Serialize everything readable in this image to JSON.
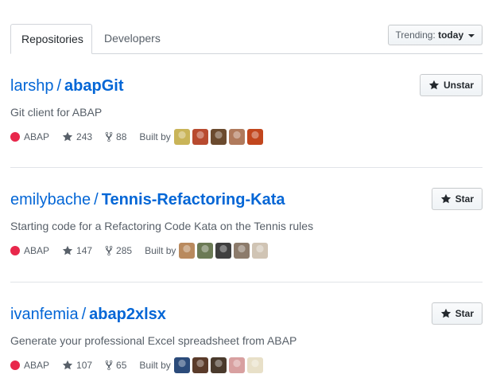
{
  "tabs": [
    {
      "label": "Repositories",
      "active": true
    },
    {
      "label": "Developers",
      "active": false
    }
  ],
  "trending": {
    "label": "Trending:",
    "value": "today"
  },
  "language_color": "#e8274b",
  "repos": [
    {
      "owner": "larshp",
      "separator": "/",
      "name": "abapGit",
      "description": "Git client for ABAP",
      "language": "ABAP",
      "stars": "243",
      "forks": "88",
      "built_by": "Built by",
      "star_button": "Unstar",
      "avatars": [
        "#c9b458",
        "#b84a2f",
        "#6b4a2e",
        "#b07a5c",
        "#c2461d"
      ]
    },
    {
      "owner": "emilybache",
      "separator": "/",
      "name": "Tennis-Refactoring-Kata",
      "description": "Starting code for a Refactoring Code Kata on the Tennis rules",
      "language": "ABAP",
      "stars": "147",
      "forks": "285",
      "built_by": "Built by",
      "star_button": "Star",
      "avatars": [
        "#b98a5e",
        "#6b7a55",
        "#3f3f3f",
        "#8c7b6b",
        "#d0c4b4"
      ]
    },
    {
      "owner": "ivanfemia",
      "separator": "/",
      "name": "abap2xlsx",
      "description": "Generate your professional Excel spreadsheet from ABAP",
      "language": "ABAP",
      "stars": "107",
      "forks": "65",
      "built_by": "Built by",
      "star_button": "Star",
      "avatars": [
        "#2b4b7a",
        "#5a3b2a",
        "#4a3a2c",
        "#d8a0a0",
        "#e8e0c8"
      ]
    }
  ]
}
